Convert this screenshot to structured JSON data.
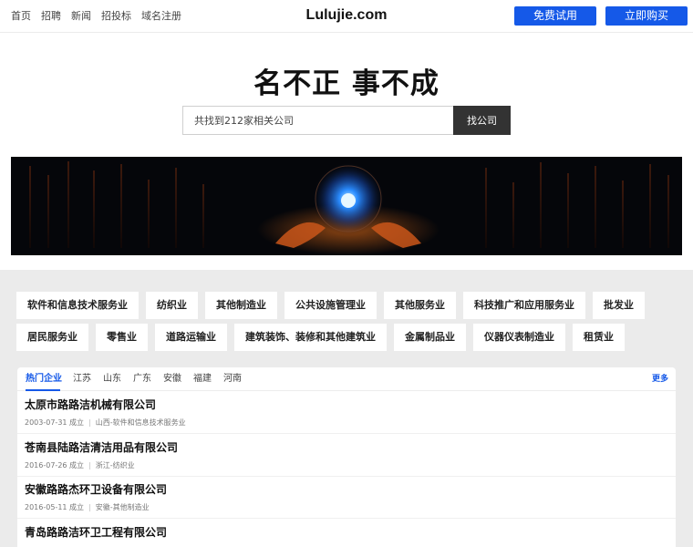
{
  "header": {
    "nav": [
      "首页",
      "招聘",
      "新闻",
      "招投标",
      "域名注册"
    ],
    "logo": "Lulujie.com",
    "trial_label": "免费试用",
    "buy_label": "立即购买"
  },
  "hero": {
    "slogan": "名不正 事不成",
    "search_placeholder": "共找到212家相关公司",
    "search_button": "找公司"
  },
  "industries": [
    "软件和信息技术服务业",
    "纺织业",
    "其他制造业",
    "公共设施管理业",
    "其他服务业",
    "科技推广和应用服务业",
    "批发业",
    "居民服务业",
    "零售业",
    "道路运输业",
    "建筑装饰、装修和其他建筑业",
    "金属制品业",
    "仪器仪表制造业",
    "租赁业"
  ],
  "companies_panel": {
    "tabs": [
      "热门企业",
      "江苏",
      "山东",
      "广东",
      "安徽",
      "福建",
      "河南"
    ],
    "more_label": "更多",
    "items": [
      {
        "name": "太原市路路洁机械有限公司",
        "date": "2003-07-31 成立",
        "category": "山西-软件和信息技术服务业"
      },
      {
        "name": "苍南县陆路洁清洁用品有限公司",
        "date": "2016-07-26 成立",
        "category": "浙江-纺织业"
      },
      {
        "name": "安徽路路杰环卫设备有限公司",
        "date": "2016-05-11 成立",
        "category": "安徽-其他制造业"
      },
      {
        "name": "青岛路路洁环卫工程有限公司",
        "date": "",
        "category": ""
      }
    ]
  },
  "colors": {
    "accent": "#1559e8",
    "search_button": "#333333",
    "section_bg": "#ebebeb"
  }
}
